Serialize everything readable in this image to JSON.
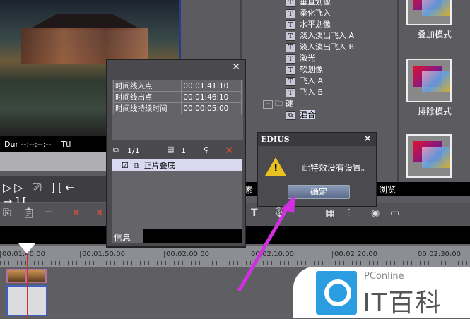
{
  "preview": {
    "dur_label": "Dur --:--:--:--",
    "ttl_label": "Ttl"
  },
  "playback": {
    "controls": "▷▷ ⎚ ][← →]["
  },
  "toolbar": {
    "icons": [
      "copy",
      "paste",
      "group",
      "delete-cut",
      "delete",
      "title",
      "mic",
      "audio",
      "grid",
      "mixer",
      "color",
      "window"
    ]
  },
  "ruler": {
    "timecodes": [
      "00:01:40:00",
      "00:01:50:00",
      "00:02:00:00",
      "00:02:10:00",
      "00:02:20:00",
      "00:02:30:00"
    ]
  },
  "tree": {
    "items": [
      "垂直划像",
      "柔化飞入",
      "水平划像",
      "淡入淡出飞入 A",
      "淡入淡出飞入 B",
      "激光",
      "软划像",
      "飞入 A",
      "飞入 B"
    ],
    "folder": "键",
    "selected": "混合",
    "icon_letter": "T"
  },
  "effects_panel": {
    "labels": [
      "叠加模式",
      "排除模式"
    ]
  },
  "tabs": {
    "left": "素",
    "right": "浏览"
  },
  "info_panel": {
    "rows": [
      {
        "label": "时间线入点",
        "value": "00:01:41:10"
      },
      {
        "label": "时间线出点",
        "value": "00:01:46:10"
      },
      {
        "label": "时间线持续时间",
        "value": "00:00:05:00"
      }
    ],
    "layer_count": "1/1",
    "filter_count": "1",
    "effect": "正片叠底",
    "tab": "信息"
  },
  "dialog": {
    "title": "EDIUS",
    "message": "此特效没有设置。",
    "ok": "确定"
  },
  "watermark": {
    "brand": "PConline",
    "name": "IT百科"
  },
  "colors": {
    "arrow": "#d030e0",
    "accent": "#2a9ee0"
  }
}
